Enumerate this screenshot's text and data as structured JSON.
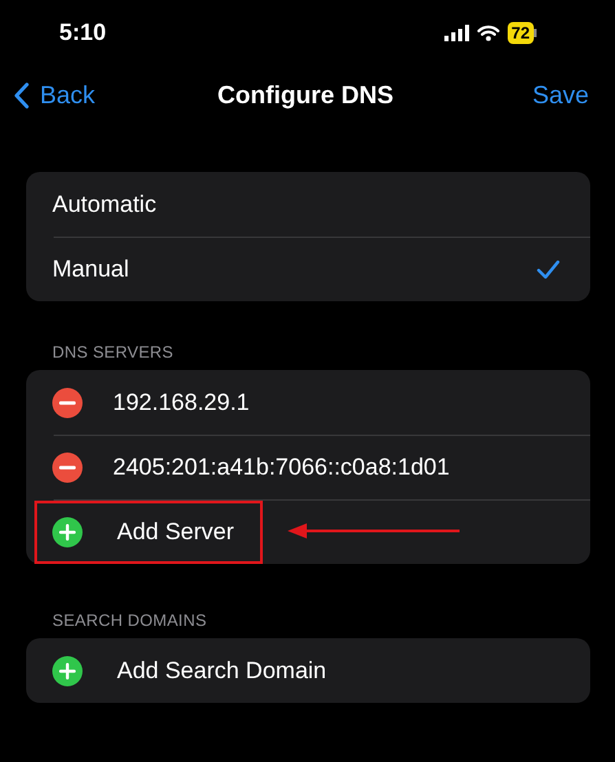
{
  "status_bar": {
    "time": "5:10",
    "battery": "72"
  },
  "nav": {
    "back": "Back",
    "title": "Configure DNS",
    "action": "Save"
  },
  "modes": [
    {
      "label": "Automatic",
      "selected": false
    },
    {
      "label": "Manual",
      "selected": true
    }
  ],
  "dns_servers": {
    "header": "DNS SERVERS",
    "entries": [
      {
        "kind": "remove",
        "text": "192.168.29.1"
      },
      {
        "kind": "remove",
        "text": "2405:201:a41b:7066::c0a8:1d01"
      },
      {
        "kind": "add",
        "text": "Add Server",
        "highlighted": true
      }
    ]
  },
  "search_domains": {
    "header": "SEARCH DOMAINS",
    "entries": [
      {
        "kind": "add",
        "text": "Add Search Domain",
        "highlighted": false
      }
    ]
  }
}
